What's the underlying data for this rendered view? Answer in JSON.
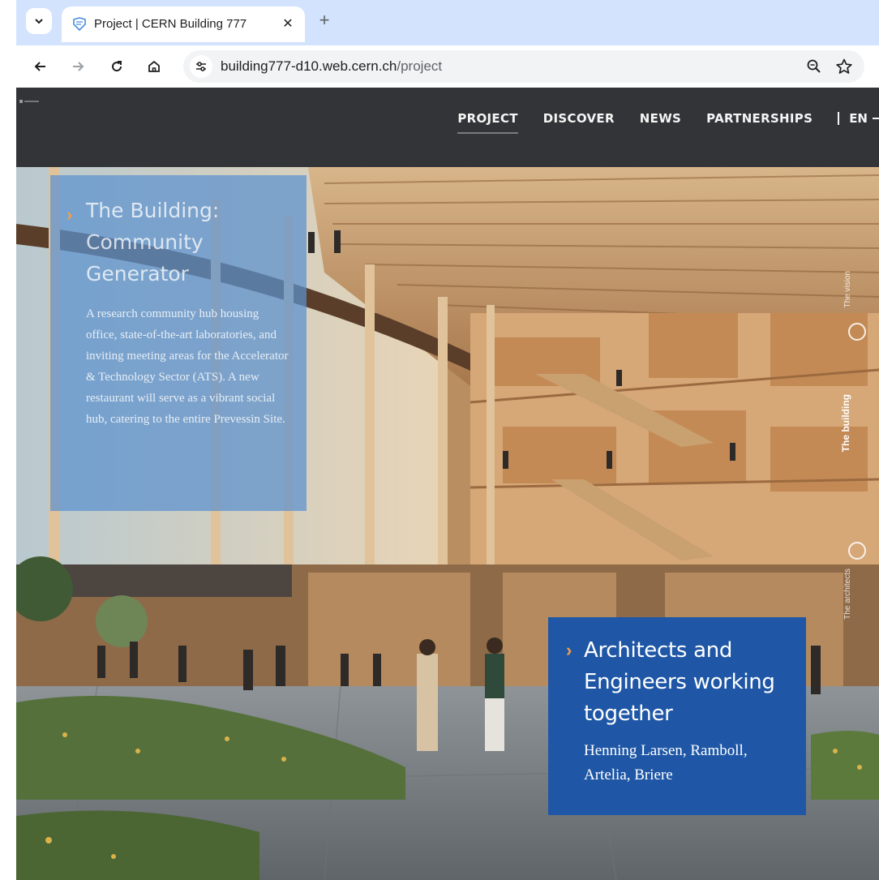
{
  "browser": {
    "tab_title": "Project | CERN Building 777",
    "tab_close": "✕",
    "new_tab": "+",
    "url_host": "building777-d10.web.cern.ch",
    "url_path": "/project"
  },
  "site": {
    "nav": [
      "PROJECT",
      "DISCOVER",
      "NEWS",
      "PARTNERSHIPS"
    ],
    "active_nav": "PROJECT",
    "language": "EN"
  },
  "hero": {
    "left_panel": {
      "title": "The Building: Community Generator",
      "description": "A research community hub housing office, state-of-the-art laboratories, and inviting meeting areas for the Accelerator & Technology Sector (ATS). A new restaurant will serve as a vibrant social hub, catering to the entire Prevessin Site."
    },
    "right_panel": {
      "title": "Architects and Engineers working together",
      "description": "Henning Larsen, Ramboll, Artelia, Briere"
    },
    "side_labels": [
      "The vision",
      "The building",
      "The architects"
    ]
  },
  "colors": {
    "site_header": "#333438",
    "panel_left": "#5c91ce",
    "panel_right": "#1f57a6",
    "chevron": "#f0a04a",
    "tabbar": "#d3e3fd"
  }
}
